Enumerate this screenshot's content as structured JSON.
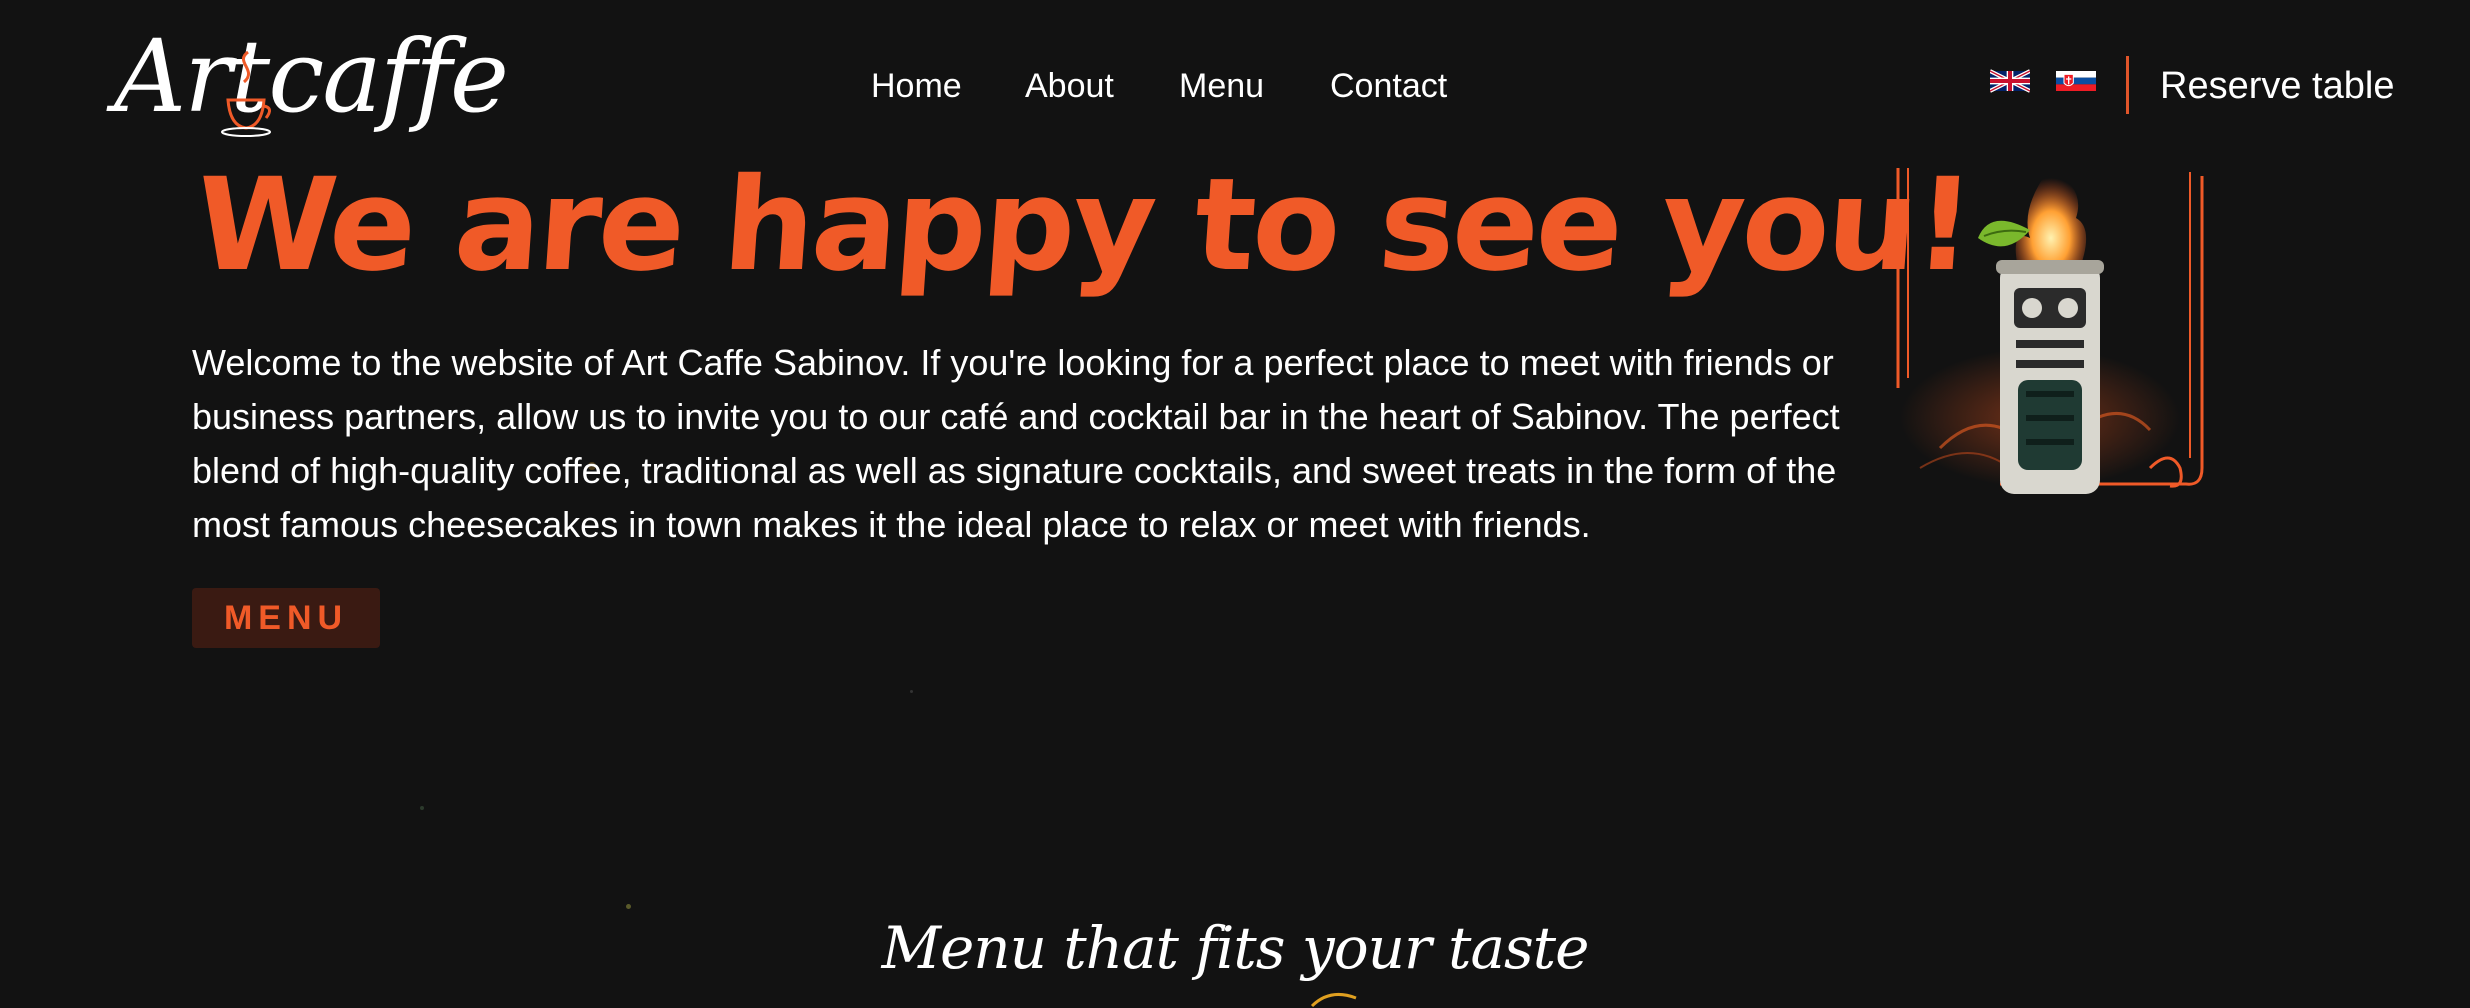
{
  "header": {
    "logo_text": "Artcaffe",
    "nav": [
      {
        "label": "Home"
      },
      {
        "label": "About"
      },
      {
        "label": "Menu"
      },
      {
        "label": "Contact"
      }
    ],
    "languages": [
      {
        "icon": "uk-flag-icon"
      },
      {
        "icon": "slovak-flag-icon"
      }
    ],
    "reserve_label": "Reserve table"
  },
  "hero": {
    "title": "We are happy to see you!",
    "text": "Welcome to the website of Art Caffe Sabinov. If you're looking for a perfect place to meet with friends or business partners, allow us to invite you to our café and cocktail bar in the heart of Sabinov. The perfect blend of high-quality coffee, traditional as well as signature cocktails, and sweet treats in the form of the most famous cheesecakes in town makes it the ideal place to relax or meet with friends.",
    "button_label": "MENU"
  },
  "section": {
    "title": "Menu that fits your taste"
  },
  "colors": {
    "background": "#121212",
    "accent": "#f05a28",
    "text": "#ffffff",
    "button_bg": "#3a1a12"
  }
}
